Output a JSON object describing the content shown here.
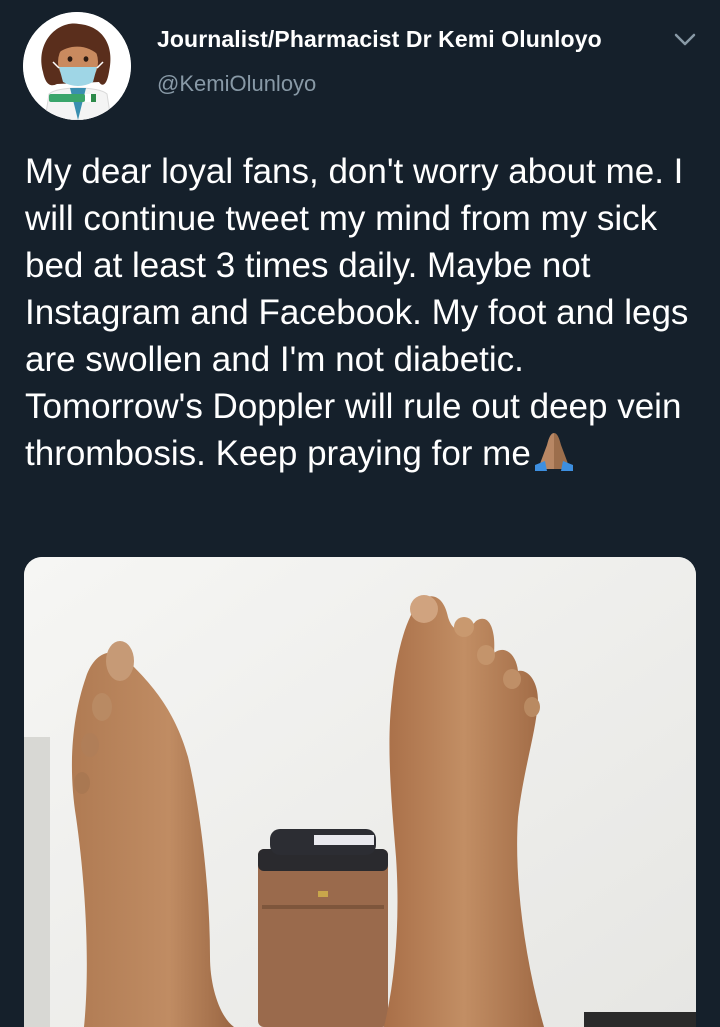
{
  "author": {
    "display_name": "Journalist/Pharmacist Dr Kemi Olunloyo",
    "handle": "@KemiOlunloyo",
    "avatar_icon": "cartoon-doctor-avatar-icon"
  },
  "menu_icon": "chevron-down-icon",
  "tweet": {
    "text": "My dear loyal fans, don't worry about me. I will continue tweet my mind from my sick bed at least 3 times daily. Maybe not Instagram and Facebook. My foot and legs are swollen and I'm not diabetic. Tomorrow's Doppler will rule out deep vein thrombosis. Keep praying for me",
    "emoji": "folded-hands-emoji"
  },
  "media": {
    "description_icon": "photo-of-swollen-feet"
  },
  "colors": {
    "background": "#15202b",
    "secondary_text": "#8899a6",
    "primary_text": "#ffffff"
  }
}
